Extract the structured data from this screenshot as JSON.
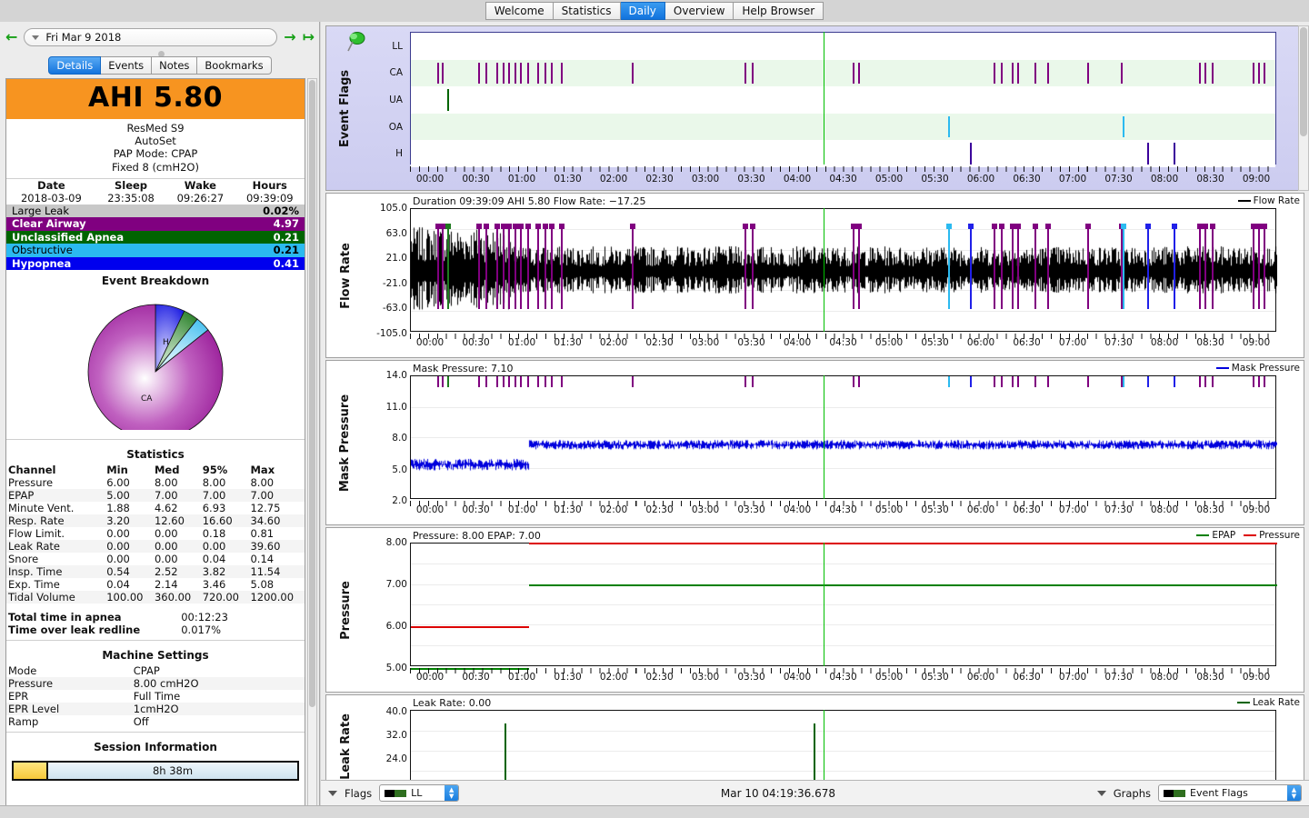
{
  "tabs": [
    {
      "label": "Welcome",
      "selected": false
    },
    {
      "label": "Statistics",
      "selected": false
    },
    {
      "label": "Daily",
      "selected": true
    },
    {
      "label": "Overview",
      "selected": false
    },
    {
      "label": "Help Browser",
      "selected": false
    }
  ],
  "sidebar": {
    "date_value": "Fri Mar 9 2018",
    "subtabs": [
      {
        "label": "Details",
        "selected": true
      },
      {
        "label": "Events",
        "selected": false
      },
      {
        "label": "Notes",
        "selected": false
      },
      {
        "label": "Bookmarks",
        "selected": false
      }
    ],
    "ahi": "AHI 5.80",
    "machine_lines": [
      "ResMed S9",
      "AutoSet",
      "PAP Mode: CPAP",
      "Fixed 8 (cmH2O)"
    ],
    "session_header": [
      "Date",
      "Sleep",
      "Wake",
      "Hours"
    ],
    "session_values": [
      "2018-03-09",
      "23:35:08",
      "09:26:27",
      "09:39:09"
    ],
    "events": [
      {
        "label": "Large Leak",
        "value": "0.02%",
        "bg": "#c8c8c8",
        "fg": "#000000"
      },
      {
        "label": "Clear Airway",
        "value": "4.97",
        "bg": "#800080",
        "fg": "#ffffff"
      },
      {
        "label": "Unclassified Apnea",
        "value": "0.21",
        "bg": "#006400",
        "fg": "#ffffff"
      },
      {
        "label": "Obstructive",
        "value": "0.21",
        "bg": "#2bbaf0",
        "fg": "#000000"
      },
      {
        "label": "Hypopnea",
        "value": "0.41",
        "bg": "#0000ee",
        "fg": "#ffffff"
      }
    ],
    "event_breakdown_title": "Event Breakdown",
    "statistics_title": "Statistics",
    "stats_header": [
      "Channel",
      "Min",
      "Med",
      "95%",
      "Max"
    ],
    "stats_rows": [
      [
        "Pressure",
        "6.00",
        "8.00",
        "8.00",
        "8.00"
      ],
      [
        "EPAP",
        "5.00",
        "7.00",
        "7.00",
        "7.00"
      ],
      [
        "Minute Vent.",
        "1.88",
        "4.62",
        "6.93",
        "12.75"
      ],
      [
        "Resp. Rate",
        "3.20",
        "12.60",
        "16.60",
        "34.60"
      ],
      [
        "Flow Limit.",
        "0.00",
        "0.00",
        "0.18",
        "0.81"
      ],
      [
        "Leak Rate",
        "0.00",
        "0.00",
        "0.00",
        "39.60"
      ],
      [
        "Snore",
        "0.00",
        "0.00",
        "0.04",
        "0.14"
      ],
      [
        "Insp. Time",
        "0.54",
        "2.52",
        "3.82",
        "11.54"
      ],
      [
        "Exp. Time",
        "0.04",
        "2.14",
        "3.46",
        "5.08"
      ],
      [
        "Tidal Volume",
        "100.00",
        "360.00",
        "720.00",
        "1200.00"
      ]
    ],
    "totals": [
      [
        "Total time in apnea",
        "00:12:23"
      ],
      [
        "Time over leak redline",
        "0.017%"
      ]
    ],
    "machine_settings_title": "Machine Settings",
    "machine_settings": [
      [
        "Mode",
        "CPAP"
      ],
      [
        "Pressure",
        "8.00 cmH2O"
      ],
      [
        "EPR",
        "Full Time"
      ],
      [
        "EPR Level",
        "1cmH2O"
      ],
      [
        "Ramp",
        "Off"
      ]
    ],
    "session_info_title": "Session Information",
    "session_duration": "8h 38m"
  },
  "chart_data": [
    {
      "type": "table",
      "name": "event-flags",
      "title": "Event Flags",
      "lanes": [
        "LL",
        "CA",
        "UA",
        "OA",
        "H"
      ],
      "xlabel": "",
      "xticks": [
        "00:00",
        "00:30",
        "01:00",
        "01:30",
        "02:00",
        "02:30",
        "03:00",
        "03:30",
        "04:00",
        "04:30",
        "05:00",
        "05:30",
        "06:00",
        "06:30",
        "07:00",
        "07:30",
        "08:00",
        "08:30",
        "09:00"
      ],
      "lane_colors": {
        "LL": "#006400",
        "CA": "#800080",
        "UA": "#006400",
        "OA": "#2bbaf0",
        "H": "#3b009b"
      },
      "events": {
        "CA": [
          3.0,
          3.6,
          7.8,
          8.6,
          9.9,
          10.6,
          11.2,
          12.0,
          12.6,
          13.4,
          14.6,
          15.4,
          16.2,
          17.3,
          25.5,
          38.5,
          39.3,
          51.0,
          51.6,
          67.3,
          68.1,
          69.4,
          70.0,
          72.0,
          73.5,
          78.1,
          82.0,
          91.0,
          91.6,
          92.4,
          97.2,
          97.8,
          98.4
        ],
        "UA": [
          4.2
        ],
        "OA": [
          62.0,
          82.2
        ],
        "H": [
          64.5,
          85.0,
          88.0
        ]
      }
    },
    {
      "type": "line",
      "name": "flow-rate",
      "title": "Duration 09:39:09 AHI 5.80 Flow Rate: −17.25",
      "legend": [
        {
          "label": "Flow Rate",
          "color": "#000000"
        }
      ],
      "ylabel": "Flow Rate",
      "yticks": [
        "105.0",
        "63.0",
        "21.0",
        "-21.0",
        "-63.0",
        "-105.0"
      ],
      "ylim": [
        -105.0,
        105.0
      ],
      "xticks": [
        "00:00",
        "00:30",
        "01:00",
        "01:30",
        "02:00",
        "02:30",
        "03:00",
        "03:30",
        "04:00",
        "04:30",
        "05:00",
        "05:30",
        "06:00",
        "06:30",
        "07:00",
        "07:30",
        "08:00",
        "08:30",
        "09:00"
      ]
    },
    {
      "type": "line",
      "name": "mask-pressure",
      "title": "Mask Pressure: 7.10",
      "legend": [
        {
          "label": "Mask Pressure",
          "color": "#0000dd"
        }
      ],
      "ylabel": "Mask Pressure",
      "yticks": [
        "14.0",
        "11.0",
        "8.0",
        "5.0",
        "2.0"
      ],
      "ylim": [
        2.0,
        14.0
      ],
      "xticks": [
        "00:00",
        "00:30",
        "01:00",
        "01:30",
        "02:00",
        "02:30",
        "03:00",
        "03:30",
        "04:00",
        "04:30",
        "05:00",
        "05:30",
        "06:00",
        "06:30",
        "07:00",
        "07:30",
        "08:00",
        "08:30",
        "09:00"
      ]
    },
    {
      "type": "line",
      "name": "pressure",
      "title": "Pressure: 8.00 EPAP: 7.00",
      "legend": [
        {
          "label": "EPAP",
          "color": "#008000"
        },
        {
          "label": "Pressure",
          "color": "#dd0000"
        }
      ],
      "ylabel": "Pressure",
      "yticks": [
        "8.00",
        "7.00",
        "6.00",
        "5.00"
      ],
      "ylim": [
        5.0,
        8.0
      ],
      "series": [
        {
          "name": "EPAP",
          "color": "#008000",
          "segments": [
            [
              0,
              13.6,
              5.0
            ],
            [
              13.6,
              100,
              7.0
            ]
          ]
        },
        {
          "name": "Pressure",
          "color": "#dd0000",
          "segments": [
            [
              0,
              13.6,
              6.0
            ],
            [
              13.6,
              100,
              8.0
            ]
          ]
        }
      ],
      "xticks": [
        "00:00",
        "00:30",
        "01:00",
        "01:30",
        "02:00",
        "02:30",
        "03:00",
        "03:30",
        "04:00",
        "04:30",
        "05:00",
        "05:30",
        "06:00",
        "06:30",
        "07:00",
        "07:30",
        "08:00",
        "08:30",
        "09:00"
      ]
    },
    {
      "type": "line",
      "name": "leak-rate",
      "title": "Leak Rate: 0.00",
      "legend": [
        {
          "label": "Leak Rate",
          "color": "#006400"
        }
      ],
      "ylabel": "Leak Rate",
      "yticks": [
        "40.0",
        "32.0",
        "24.0"
      ],
      "ylim": [
        16.0,
        40.0
      ],
      "spikes": [
        10.8,
        46.5
      ]
    }
  ],
  "pie": {
    "title": "Event Breakdown",
    "type": "pie",
    "slices": [
      {
        "label": "CA",
        "value": 4.97,
        "color": "#a32ba3"
      },
      {
        "label": "H",
        "value": 0.41,
        "color": "#2020e8"
      },
      {
        "label": "UA",
        "value": 0.21,
        "color": "#1f7a1f"
      },
      {
        "label": "OA",
        "value": 0.21,
        "color": "#47c6f5"
      }
    ]
  },
  "statusbar": {
    "flags_label": "Flags",
    "flags_value": "LL",
    "clock": "Mar 10 04:19:36.678",
    "graphs_label": "Graphs",
    "graphs_value": "Event Flags"
  }
}
